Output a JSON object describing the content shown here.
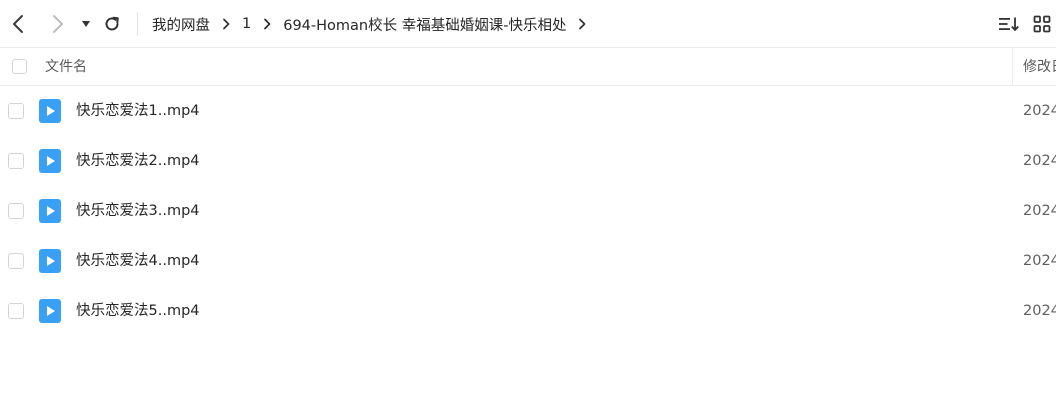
{
  "toolbar": {
    "back_icon": "chevron-left-icon",
    "forward_icon": "chevron-right-icon",
    "history_icon": "caret-down-icon",
    "refresh_icon": "refresh-icon",
    "sort_icon": "sort-icon",
    "view_icon": "grid-view-icon"
  },
  "breadcrumb": [
    {
      "label": "我的网盘"
    },
    {
      "label": "1"
    },
    {
      "label": "694-Homan校长 幸福基础婚姻课-快乐相处"
    }
  ],
  "header": {
    "name_label": "文件名",
    "modified_label": "修改日期"
  },
  "files": [
    {
      "name": "快乐恋爱法1..mp4",
      "date": "2024"
    },
    {
      "name": "快乐恋爱法2..mp4",
      "date": "2024"
    },
    {
      "name": "快乐恋爱法3..mp4",
      "date": "2024"
    },
    {
      "name": "快乐恋爱法4..mp4",
      "date": "2024"
    },
    {
      "name": "快乐恋爱法5..mp4",
      "date": "2024"
    }
  ],
  "colors": {
    "video_icon": "#3aa0f5",
    "icon_gray": "#444444",
    "icon_disabled": "#bbbbbb"
  }
}
